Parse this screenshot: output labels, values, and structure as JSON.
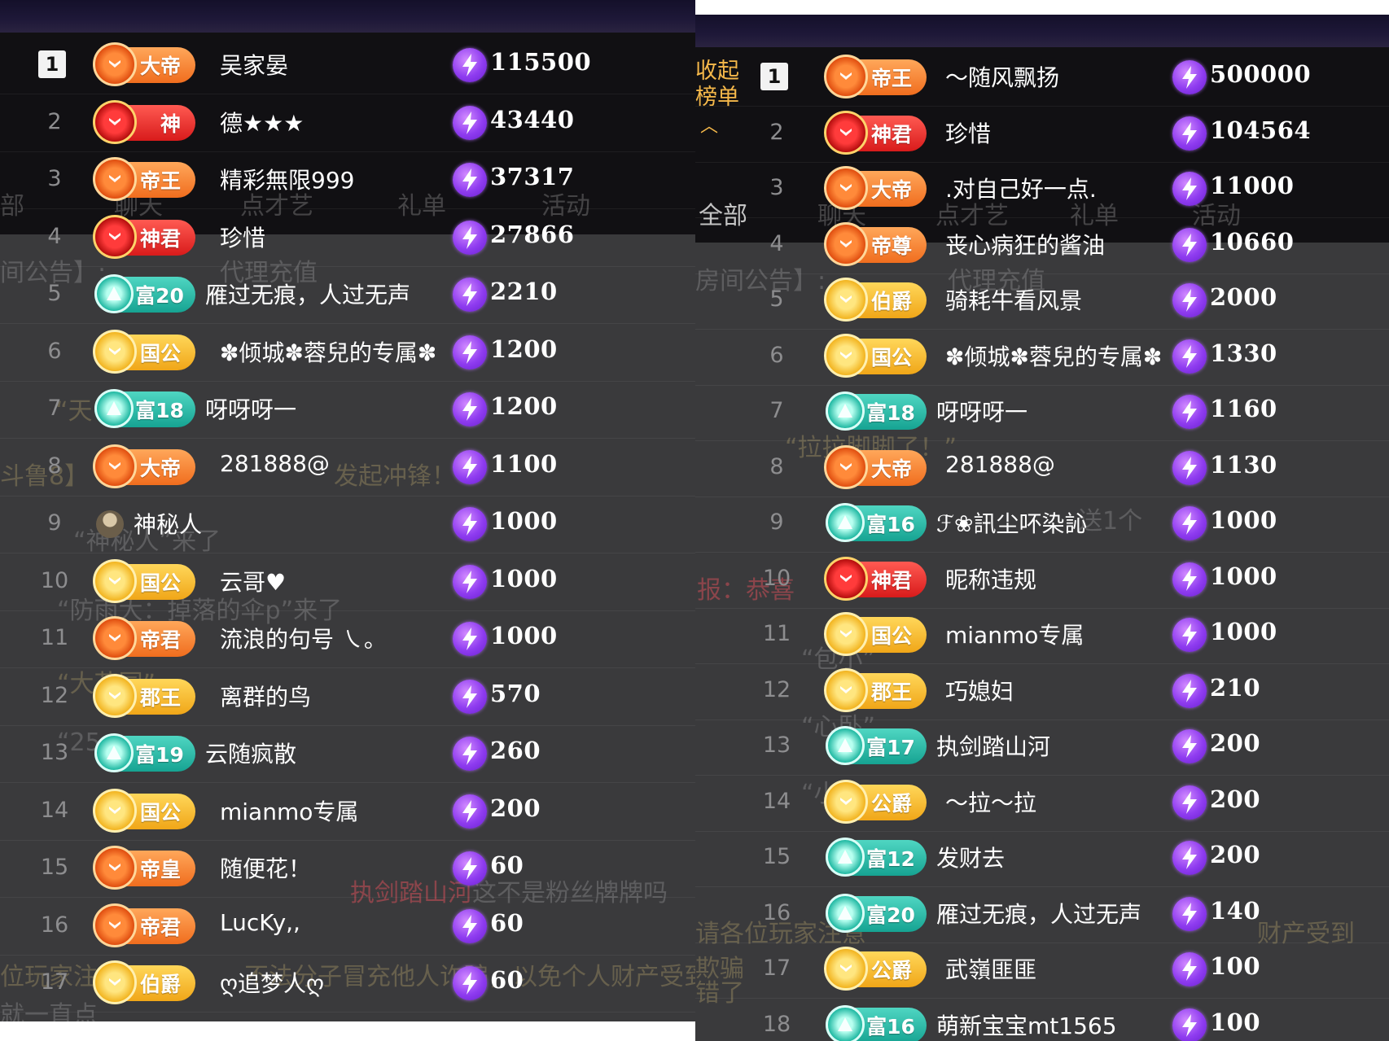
{
  "left_panel": {
    "tabs": [
      "部",
      "聊天",
      "点才艺",
      "礼单",
      "活动"
    ],
    "notice": "间公告】:",
    "notice_tags": [
      "代理充值"
    ],
    "ghost_texts": [
      "“天",
      "斗鲁8】",
      "发起冲锋！",
      "“神秘人”来了",
      "“防雨大：掉落的伞p”来了",
      "“大花园”",
      "“25",
      "执剑踏山河",
      "这不是粉丝牌牌吗",
      "位玩家注意",
      "不法分子冒充他人诈骗，以免个人财产受到损",
      "就一直点"
    ],
    "rows": [
      {
        "rank": "1",
        "badge": "大帝",
        "badge_style": "orange",
        "name": "吴家晏",
        "value": "115500"
      },
      {
        "rank": "2",
        "badge": "神",
        "badge_style": "red",
        "name": "德★★★",
        "value": "43440"
      },
      {
        "rank": "3",
        "badge": "帝王",
        "badge_style": "orange",
        "name": "精彩無限999",
        "value": "37317"
      },
      {
        "rank": "4",
        "badge": "神君",
        "badge_style": "red",
        "name": "珍惜",
        "value": "27866"
      },
      {
        "rank": "5",
        "badge": "富20",
        "badge_style": "teal",
        "name": "雁过无痕，人过无声",
        "value": "2210"
      },
      {
        "rank": "6",
        "badge": "国公",
        "badge_style": "gold",
        "name": "✽倾城✽蓉兒的专属✽",
        "value": "1200"
      },
      {
        "rank": "7",
        "badge": "富18",
        "badge_style": "teal",
        "name": "呀呀呀一",
        "value": "1200"
      },
      {
        "rank": "8",
        "badge": "大帝",
        "badge_style": "orange",
        "name": "281888@",
        "value": "1100"
      },
      {
        "rank": "9",
        "badge": "",
        "badge_style": "none",
        "name": "神秘人",
        "value": "1000"
      },
      {
        "rank": "10",
        "badge": "国公",
        "badge_style": "gold",
        "name": "云哥♥",
        "value": "1000"
      },
      {
        "rank": "11",
        "badge": "帝君",
        "badge_style": "orange",
        "name": "流浪的句号 ㇏。",
        "value": "1000"
      },
      {
        "rank": "12",
        "badge": "郡王",
        "badge_style": "gold",
        "name": "离群的鸟",
        "value": "570"
      },
      {
        "rank": "13",
        "badge": "富19",
        "badge_style": "teal",
        "name": "云随疯散",
        "value": "260"
      },
      {
        "rank": "14",
        "badge": "国公",
        "badge_style": "gold",
        "name": "mianmo专属",
        "value": "200"
      },
      {
        "rank": "15",
        "badge": "帝皇",
        "badge_style": "orange",
        "name": "随便花！",
        "value": "60"
      },
      {
        "rank": "16",
        "badge": "帝君",
        "badge_style": "orange",
        "name": "LucKy,,",
        "value": "60"
      },
      {
        "rank": "17",
        "badge": "伯爵",
        "badge_style": "gold",
        "name": "ღ追梦人ღ",
        "value": "60"
      }
    ]
  },
  "right_panel": {
    "collapse_label": "收起榜单",
    "tabs": [
      "全部",
      "聊天",
      "点才艺",
      "礼单",
      "活动"
    ],
    "notice": "房间公告】:",
    "notice_tags": [
      "代理充值"
    ],
    "ghost_texts": [
      "“拉拉脚脚了！”",
      "送1个",
      "报：恭喜",
      "“包小”",
      "“心卧”",
      "“小”",
      "请各位玩家注意",
      "财产受到",
      "欺骗",
      "错了"
    ],
    "rows": [
      {
        "rank": "1",
        "badge": "帝王",
        "badge_style": "orange",
        "name": "～随风飘扬",
        "value": "500000"
      },
      {
        "rank": "2",
        "badge": "神君",
        "badge_style": "red",
        "name": "珍惜",
        "value": "104564"
      },
      {
        "rank": "3",
        "badge": "大帝",
        "badge_style": "orange",
        "name": ".对自己好一点.",
        "value": "11000"
      },
      {
        "rank": "4",
        "badge": "帝尊",
        "badge_style": "orange",
        "name": "丧心病狂的酱油",
        "value": "10660"
      },
      {
        "rank": "5",
        "badge": "伯爵",
        "badge_style": "gold",
        "name": "骑耗牛看风景",
        "value": "2000"
      },
      {
        "rank": "6",
        "badge": "国公",
        "badge_style": "gold",
        "name": "✽倾城✽蓉兒的专属✽",
        "value": "1330"
      },
      {
        "rank": "7",
        "badge": "富18",
        "badge_style": "teal",
        "name": "呀呀呀一",
        "value": "1160"
      },
      {
        "rank": "8",
        "badge": "大帝",
        "badge_style": "orange",
        "name": "281888@",
        "value": "1130"
      },
      {
        "rank": "9",
        "badge": "富16",
        "badge_style": "teal",
        "name": "ℱ❀訊尘吥染訫",
        "value": "1000"
      },
      {
        "rank": "10",
        "badge": "神君",
        "badge_style": "red",
        "name": "昵称违规",
        "value": "1000"
      },
      {
        "rank": "11",
        "badge": "国公",
        "badge_style": "gold",
        "name": "mianmo专属",
        "value": "1000"
      },
      {
        "rank": "12",
        "badge": "郡王",
        "badge_style": "gold",
        "name": "巧媳妇",
        "value": "210"
      },
      {
        "rank": "13",
        "badge": "富17",
        "badge_style": "teal",
        "name": "执剑踏山河",
        "value": "200"
      },
      {
        "rank": "14",
        "badge": "公爵",
        "badge_style": "gold",
        "name": "～拉～拉",
        "value": "200"
      },
      {
        "rank": "15",
        "badge": "富12",
        "badge_style": "teal",
        "name": "发财去",
        "value": "200"
      },
      {
        "rank": "16",
        "badge": "富20",
        "badge_style": "teal",
        "name": "雁过无痕，人过无声",
        "value": "140"
      },
      {
        "rank": "17",
        "badge": "公爵",
        "badge_style": "gold",
        "name": "武嶺匪匪",
        "value": "100"
      },
      {
        "rank": "18",
        "badge": "富16",
        "badge_style": "teal",
        "name": "萌新宝宝mt1565",
        "value": "100"
      }
    ]
  },
  "colors": {
    "orange_badge": "#f06d1e",
    "red_badge": "#d81b1b",
    "gold_badge": "#f0a618",
    "teal_badge": "#16a392",
    "bolt": "#8f3cf0",
    "background": "#3a3a3c"
  },
  "icons": {
    "currency": "lightning-bolt-icon",
    "rank_emblem": "crest-icon",
    "mystery_user": "avatar-icon"
  }
}
